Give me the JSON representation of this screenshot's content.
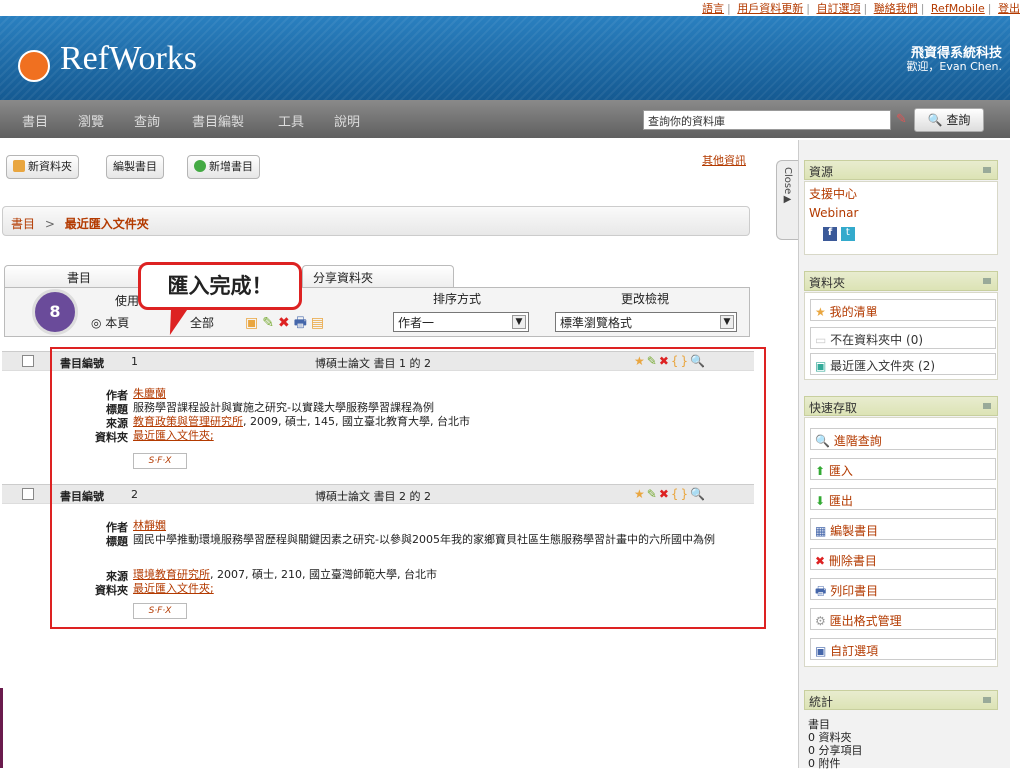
{
  "top_links": [
    "語言",
    "用戶資料更新",
    "自訂選項",
    "聯絡我們",
    "RefMobile",
    "登出"
  ],
  "brand": {
    "logo_text": "RefWorks",
    "company": "飛資得系統科技",
    "welcome": "歡迎，Evan Chen."
  },
  "nav": {
    "items": [
      "書目",
      "瀏覽",
      "查詢",
      "書目編製",
      "工具",
      "說明"
    ],
    "search_value": "查詢你的資料庫",
    "search_button": "查詢"
  },
  "actions": {
    "new_folder": "新資料夾",
    "create_bib": "編製書目",
    "new_ref": "新增書目",
    "more_info": "其他資訊"
  },
  "breadcrumb": {
    "root": "書目",
    "sep": ">",
    "current": "最近匯入文件夾"
  },
  "tabs": {
    "refs": "書目",
    "shared": "分享資料夾"
  },
  "toolbar": {
    "use_label": "使用",
    "page_opt": "本頁",
    "all_opt": "全部",
    "sort_label": "排序方式",
    "sort_value": "作者一",
    "view_label": "更改檢視",
    "view_value": "標準瀏覽格式"
  },
  "callout": {
    "text": "匯入完成！",
    "step": "8"
  },
  "labels": {
    "ref_id": "書目編號",
    "author": "作者",
    "title": "標題",
    "source": "來源",
    "folder": "資料夾",
    "sfx": "S·F·X"
  },
  "references": [
    {
      "id": "1",
      "type_title": "博碩士論文 書目 1 的 2",
      "author": "朱慶蘭",
      "title": "服務學習課程設計與實施之研究-以實踐大學服務學習課程為例",
      "source_link": "教育政策與管理研究所",
      "source_rest": ", 2009, 碩士, 145, 國立臺北教育大學, 台北市",
      "folder": "最近匯入文件夾;"
    },
    {
      "id": "2",
      "type_title": "博碩士論文 書目 2 的 2",
      "author": "林靜嫻",
      "title": "國民中學推動環境服務學習歷程與關鍵因素之研究-以參與2005年我的家鄉寶貝社區生態服務學習計畫中的六所國中為例",
      "source_link": "環境教育研究所",
      "source_rest": ", 2007, 碩士, 210, 國立臺灣師範大學, 台北市",
      "folder": "最近匯入文件夾;"
    }
  ],
  "sidebar": {
    "close_label": "Close",
    "resources": {
      "title": "資源",
      "links": [
        "支援中心",
        "Webinar"
      ]
    },
    "folders": {
      "title": "資料夾",
      "items": [
        {
          "label": "我的清單",
          "count": ""
        },
        {
          "label": "不在資料夾中",
          "count": "(0)"
        },
        {
          "label": "最近匯入文件夾",
          "count": "(2)"
        }
      ]
    },
    "quick": {
      "title": "快速存取",
      "items": [
        "進階查詢",
        "匯入",
        "匯出",
        "編製書目",
        "刪除書目",
        "列印書目",
        "匯出格式管理",
        "自訂選項"
      ]
    },
    "stats": {
      "title": "統計",
      "lines": [
        "書目",
        "0 資料夾",
        "0 分享項目",
        "0 附件"
      ]
    }
  },
  "colors": {
    "accent": "#b33a00",
    "header_blue": "#1b6aa5",
    "highlight_red": "#dd2222",
    "badge_purple": "#6a4b9a"
  }
}
